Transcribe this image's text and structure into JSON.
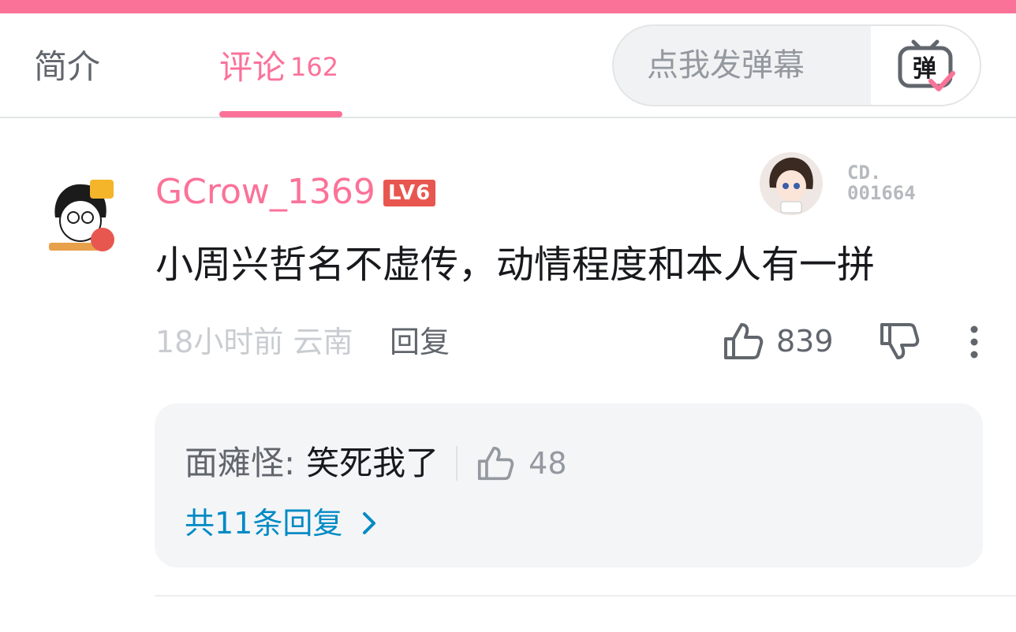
{
  "tabs": {
    "intro_label": "简介",
    "comments_label": "评论",
    "comments_count": "162"
  },
  "danmaku": {
    "placeholder": "点我发弹幕",
    "button_glyph": "弹"
  },
  "comment": {
    "username": "GCrow_1369",
    "level": "LV6",
    "medal_text_line1": "CD.",
    "medal_text_line2": "001664",
    "content": "小周兴哲名不虚传，动情程度和本人有一拼",
    "time": "18小时前",
    "location": "云南",
    "reply_label": "回复",
    "like_count": "839"
  },
  "sub_reply": {
    "author": "面瘫怪:",
    "text": "笑死我了",
    "like_count": "48",
    "more_label": "共11条回复"
  },
  "colors": {
    "accent_pink": "#fb7299",
    "link_blue": "#008ac5",
    "level_red": "#e8574f"
  },
  "icons": [
    "tv-danmaku-icon",
    "thumb-up-icon",
    "thumb-down-icon",
    "more-vertical-icon",
    "chevron-right-icon"
  ]
}
